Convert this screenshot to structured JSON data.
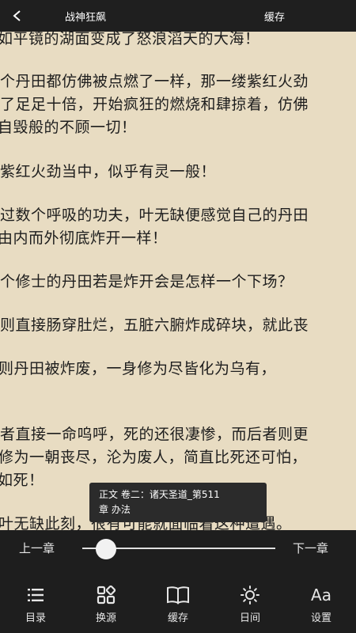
{
  "header": {
    "back_icon": "chevron-left-icon",
    "book_title": "战神狂飙",
    "cache_label": "缓存"
  },
  "content": {
    "lines": [
      "如平镜的湖面变成了怒浪滔天的大海！",
      "",
      "个丹田都仿佛被点燃了一样，那一缕紫红火劲",
      "了足足十倍，开始疯狂的燃烧和肆掠着，仿佛",
      "自毁般的不顾一切！",
      "",
      "紫红火劲当中，似乎有灵一般！",
      "",
      "过数个呼吸的功夫，叶无缺便感觉自己的丹田",
      "由内而外彻底炸开一样！",
      "",
      "个修士的丹田若是炸开会是怎样一个下场？",
      "",
      "则直接肠穿肚烂，五脏六腑炸成碎块，就此丧",
      "",
      "则丹田被炸废，一身修为尽皆化为乌有，",
      "",
      "",
      "者直接一命呜呼，死的还很凄惨，而后者则更",
      "修为一朝丧尽，沦为废人，简直比死还可怕，",
      "如死！",
      "",
      "叶无缺此刻，很有可能就面临着这种遭遇。"
    ]
  },
  "chapter_popup": {
    "line1": "正文 卷二：诸天圣道_第511",
    "line2": "章 办法"
  },
  "progress": {
    "prev_label": "上一章",
    "next_label": "下一章",
    "value": 0.07
  },
  "bottom_nav": [
    {
      "label": "目录",
      "icon": "list-icon"
    },
    {
      "label": "换源",
      "icon": "switch-source-icon"
    },
    {
      "label": "缓存",
      "icon": "book-icon"
    },
    {
      "label": "日间",
      "icon": "sun-icon"
    },
    {
      "label": "设置",
      "icon": "font-settings-icon"
    }
  ],
  "aa_glyph": "Aa"
}
